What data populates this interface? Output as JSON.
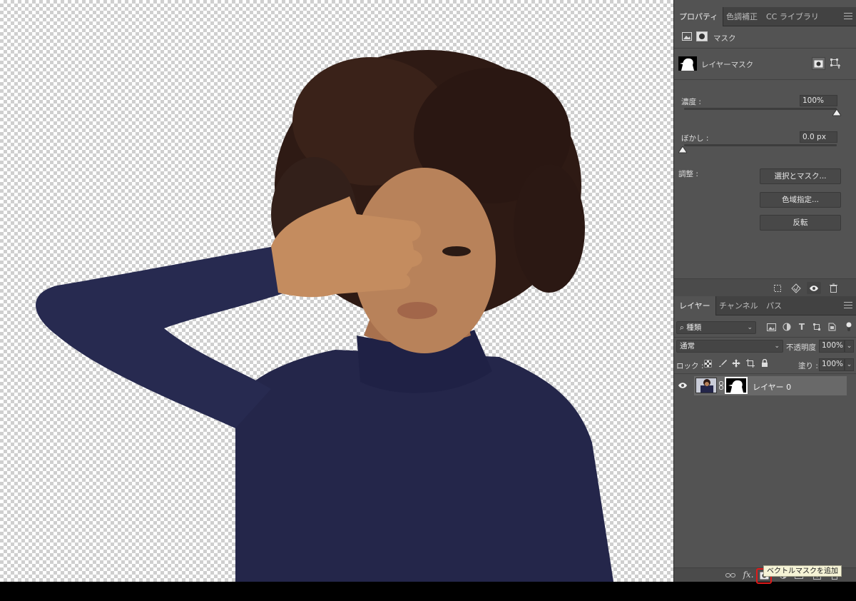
{
  "properties_panel": {
    "tabs": [
      {
        "label": "プロパティ",
        "active": true
      },
      {
        "label": "色調補正",
        "active": false
      },
      {
        "label": "CC ライブラリ",
        "active": false
      }
    ],
    "mask_header": "マスク",
    "layer_mask_label": "レイヤーマスク",
    "density": {
      "label": "濃度 :",
      "value": "100%",
      "level_percent": 100
    },
    "feather": {
      "label": "ぼかし :",
      "value": "0.0 px",
      "level_percent": 0
    },
    "adjust_label": "調整 :",
    "buttons": {
      "select_and_mask": "選択とマスク...",
      "color_range": "色域指定...",
      "invert": "反転"
    }
  },
  "layers_panel": {
    "tabs": [
      {
        "label": "レイヤー",
        "active": true
      },
      {
        "label": "チャンネル",
        "active": false
      },
      {
        "label": "パス",
        "active": false
      }
    ],
    "filter_kind": "種類",
    "blend_mode": "通常",
    "opacity_label": "不透明度 :",
    "opacity_value": "100%",
    "lock_label": "ロック :",
    "fill_label": "塗り :",
    "fill_value": "100%",
    "layers": [
      {
        "name": "レイヤー 0",
        "visible": true
      }
    ],
    "footer_fx": "fx."
  },
  "tooltip": "ベクトルマスクを追加",
  "colors": {
    "panel_bg": "#535353",
    "tab_bar": "#424242",
    "layer_selected": "#696969",
    "tooltip_bg": "#f5f3d6",
    "highlight": "#e01a1a"
  }
}
